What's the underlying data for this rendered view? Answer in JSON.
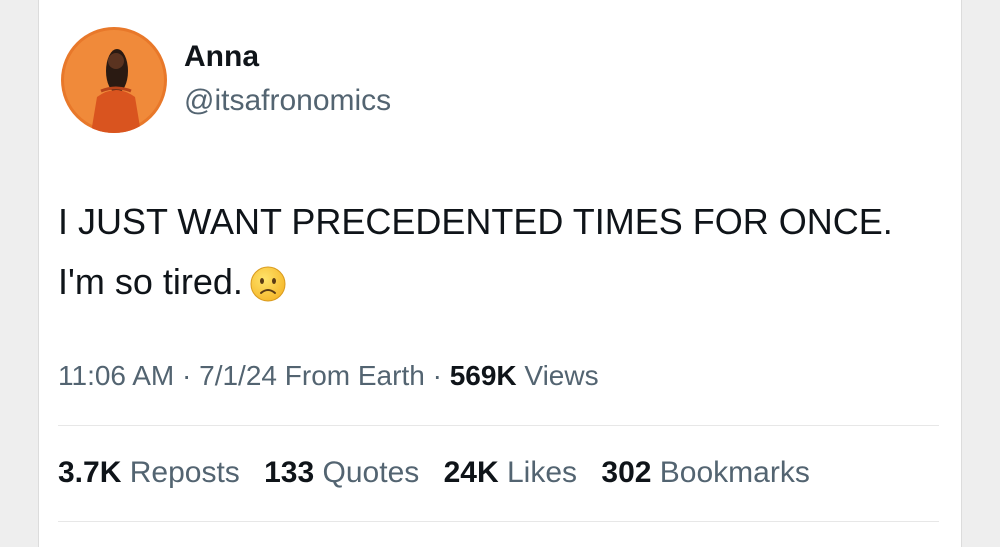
{
  "author": {
    "name": "Anna",
    "handle": "@itsafronomics",
    "avatar_icon": "profile-photo"
  },
  "tweet": {
    "line1": "I JUST WANT PRECEDENTED TIMES FOR ONCE.",
    "line2": "I'm so tired.",
    "emoji_icon": "slightly-frowning-face"
  },
  "meta": {
    "time": "11:06 AM",
    "date": "7/1/24",
    "location": "From Earth",
    "views_count": "569K",
    "views_label": "Views"
  },
  "stats": {
    "reposts_count": "3.7K",
    "reposts_label": "Reposts",
    "quotes_count": "133",
    "quotes_label": "Quotes",
    "likes_count": "24K",
    "likes_label": "Likes",
    "bookmarks_count": "302",
    "bookmarks_label": "Bookmarks"
  },
  "colors": {
    "text_primary": "#0f1419",
    "text_secondary": "#536471",
    "avatar_bg": "#e8782a"
  }
}
